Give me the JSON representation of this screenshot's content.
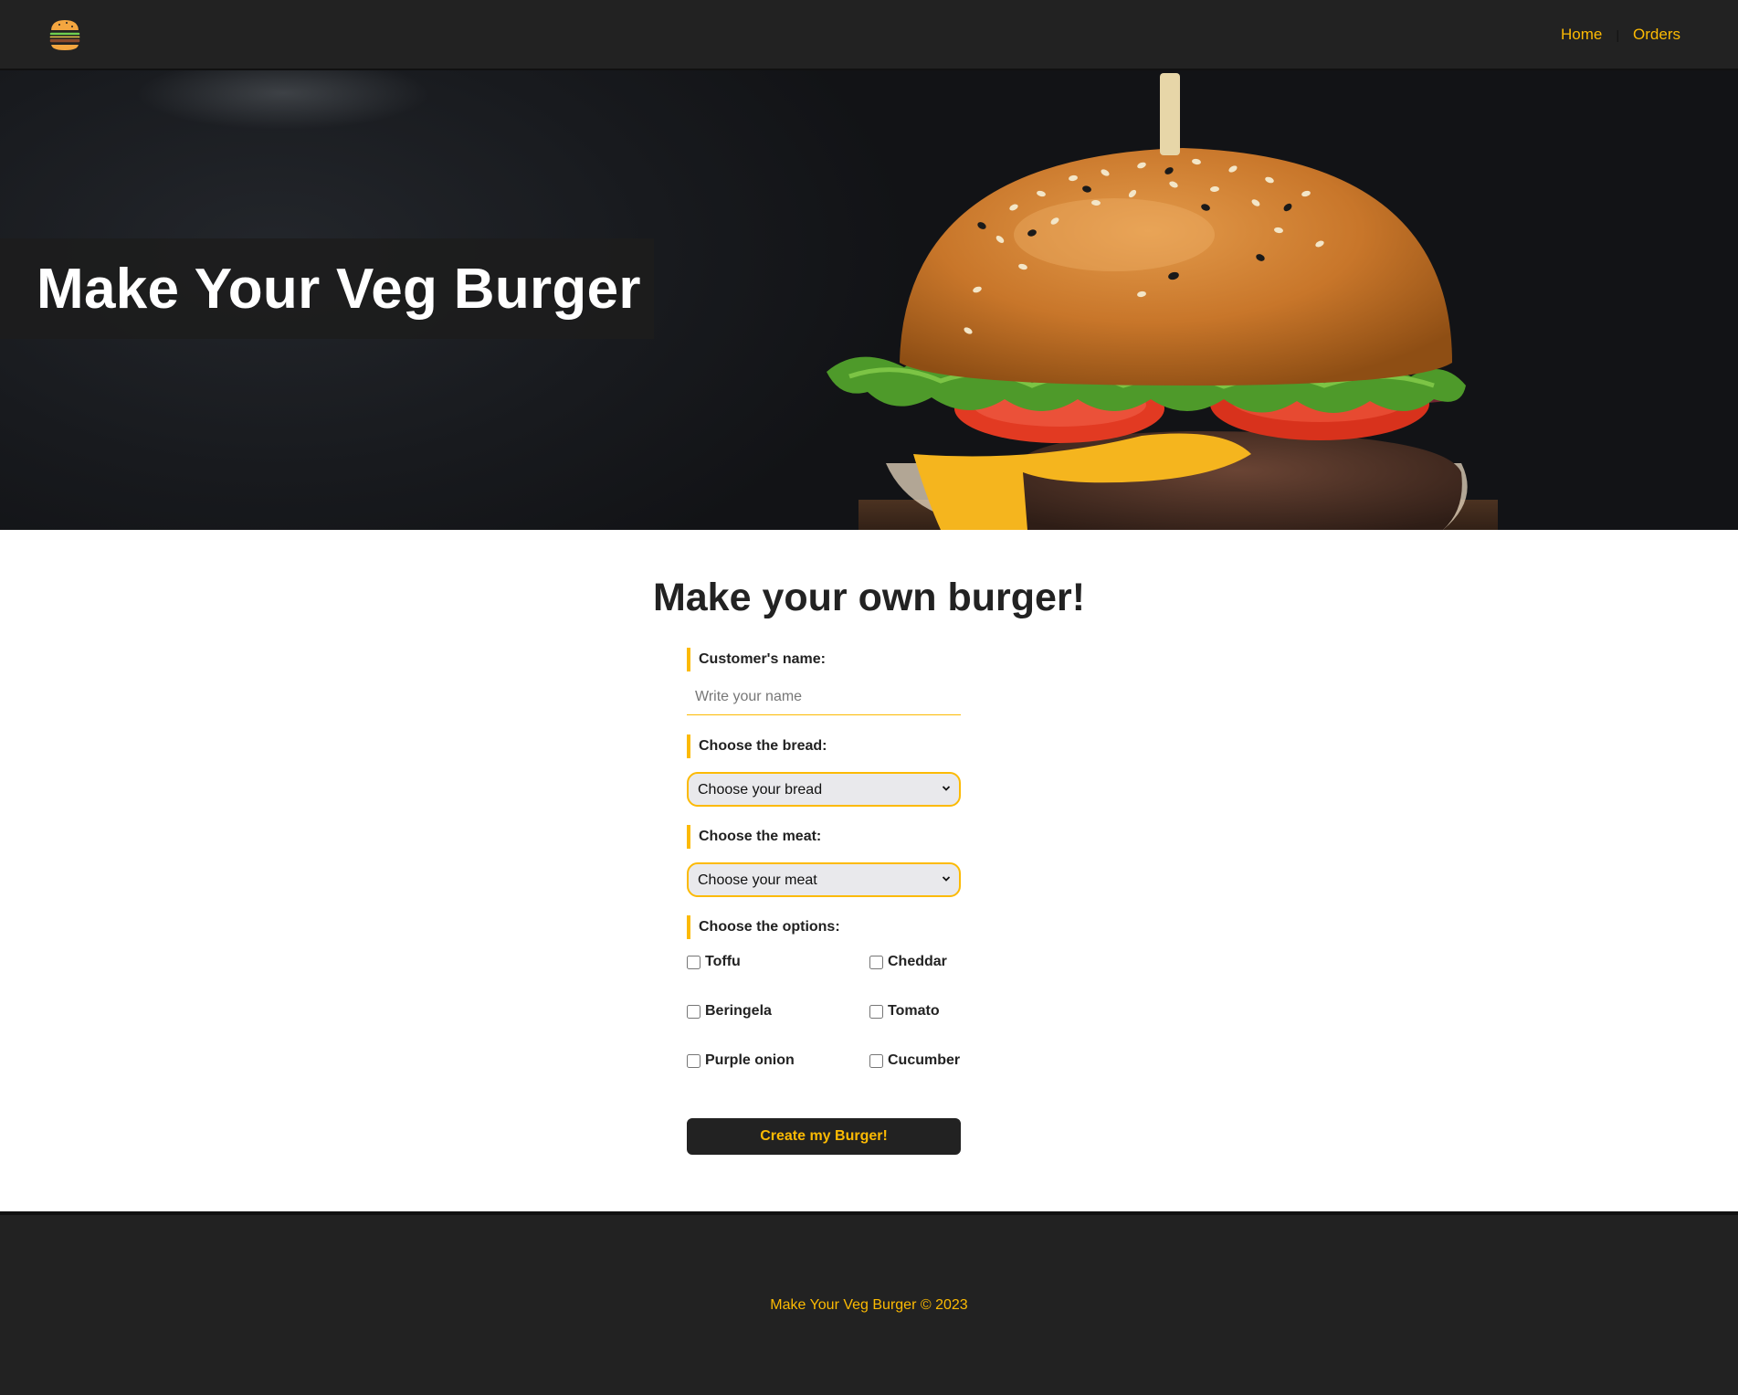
{
  "header": {
    "logo_icon": "burger-icon",
    "nav": [
      {
        "label": "Home"
      },
      {
        "label": "Orders"
      }
    ],
    "separator": "|"
  },
  "hero": {
    "title": "Make Your Veg Burger",
    "image": "burger-photo"
  },
  "main": {
    "title": "Make your own burger!",
    "form": {
      "name_label": "Customer's name:",
      "name_placeholder": "Write your name",
      "name_value": "",
      "bread_label": "Choose the bread:",
      "bread_selected": "Choose your bread",
      "meat_label": "Choose the meat:",
      "meat_selected": "Choose your meat",
      "options_label": "Choose the options:",
      "options": [
        {
          "label": "Toffu",
          "checked": false
        },
        {
          "label": "Cheddar",
          "checked": false
        },
        {
          "label": "Beringela",
          "checked": false
        },
        {
          "label": "Tomato",
          "checked": false
        },
        {
          "label": "Purple onion",
          "checked": false
        },
        {
          "label": "Cucumber",
          "checked": false
        }
      ],
      "submit_label": "Create my Burger!"
    }
  },
  "footer": {
    "text": "Make Your Veg Burger © 2023"
  },
  "colors": {
    "accent": "#FCBA03",
    "dark": "#222222",
    "white": "#FFFFFF"
  }
}
